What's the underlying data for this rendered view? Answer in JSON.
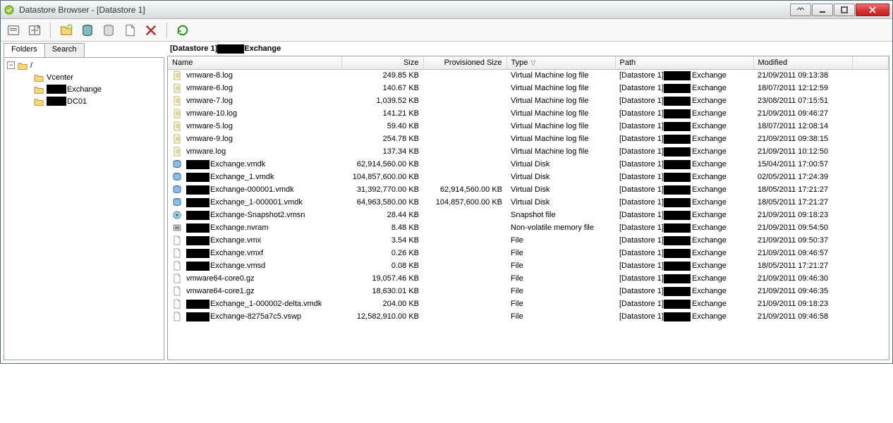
{
  "window": {
    "title": "Datastore Browser - [Datastore 1]"
  },
  "tabs": {
    "folders": "Folders",
    "search": "Search"
  },
  "tree": {
    "root": "/",
    "items": [
      {
        "name": "Vcenter",
        "redacted": false
      },
      {
        "name": "Exchange",
        "redacted": true
      },
      {
        "name": "DC01",
        "redacted": true
      }
    ]
  },
  "breadcrumb": {
    "left": "[Datastore 1]",
    "right": "Exchange"
  },
  "columns": {
    "name": "Name",
    "size": "Size",
    "provisioned": "Provisioned Size",
    "type": "Type",
    "path": "Path",
    "modified": "Modified"
  },
  "pathPrefix": "[Datastore 1]",
  "pathSuffix": "Exchange",
  "files": [
    {
      "icon": "log",
      "redacted": false,
      "name": "vmware-8.log",
      "size": "249.85 KB",
      "prov": "",
      "type": "Virtual Machine log file",
      "mod": "21/09/2011 09:13:38"
    },
    {
      "icon": "log",
      "redacted": false,
      "name": "vmware-6.log",
      "size": "140.67 KB",
      "prov": "",
      "type": "Virtual Machine log file",
      "mod": "18/07/2011 12:12:59"
    },
    {
      "icon": "log",
      "redacted": false,
      "name": "vmware-7.log",
      "size": "1,039.52 KB",
      "prov": "",
      "type": "Virtual Machine log file",
      "mod": "23/08/2011 07:15:51"
    },
    {
      "icon": "log",
      "redacted": false,
      "name": "vmware-10.log",
      "size": "141.21 KB",
      "prov": "",
      "type": "Virtual Machine log file",
      "mod": "21/09/2011 09:46:27"
    },
    {
      "icon": "log",
      "redacted": false,
      "name": "vmware-5.log",
      "size": "59.40 KB",
      "prov": "",
      "type": "Virtual Machine log file",
      "mod": "18/07/2011 12:08:14"
    },
    {
      "icon": "log",
      "redacted": false,
      "name": "vmware-9.log",
      "size": "254.78 KB",
      "prov": "",
      "type": "Virtual Machine log file",
      "mod": "21/09/2011 09:38:15"
    },
    {
      "icon": "log",
      "redacted": false,
      "name": "vmware.log",
      "size": "137.34 KB",
      "prov": "",
      "type": "Virtual Machine log file",
      "mod": "21/09/2011 10:12:50"
    },
    {
      "icon": "disk",
      "redacted": true,
      "name": "Exchange.vmdk",
      "size": "62,914,560.00 KB",
      "prov": "",
      "type": "Virtual Disk",
      "mod": "15/04/2011 17:00:57"
    },
    {
      "icon": "disk",
      "redacted": true,
      "name": "Exchange_1.vmdk",
      "size": "104,857,600.00 KB",
      "prov": "",
      "type": "Virtual Disk",
      "mod": "02/05/2011 17:24:39"
    },
    {
      "icon": "disk",
      "redacted": true,
      "name": "Exchange-000001.vmdk",
      "size": "31,392,770.00 KB",
      "prov": "62,914,560.00 KB",
      "type": "Virtual Disk",
      "mod": "18/05/2011 17:21:27"
    },
    {
      "icon": "disk",
      "redacted": true,
      "name": "Exchange_1-000001.vmdk",
      "size": "64,963,580.00 KB",
      "prov": "104,857,600.00 KB",
      "type": "Virtual Disk",
      "mod": "18/05/2011 17:21:27"
    },
    {
      "icon": "snap",
      "redacted": true,
      "name": "Exchange-Snapshot2.vmsn",
      "size": "28.44 KB",
      "prov": "",
      "type": "Snapshot file",
      "mod": "21/09/2011 09:18:23"
    },
    {
      "icon": "nvram",
      "redacted": true,
      "name": "Exchange.nvram",
      "size": "8.48 KB",
      "prov": "",
      "type": "Non-volatile memory file",
      "mod": "21/09/2011 09:54:50"
    },
    {
      "icon": "file",
      "redacted": true,
      "name": "Exchange.vmx",
      "size": "3.54 KB",
      "prov": "",
      "type": "File",
      "mod": "21/09/2011 09:50:37"
    },
    {
      "icon": "file",
      "redacted": true,
      "name": "Exchange.vmxf",
      "size": "0.26 KB",
      "prov": "",
      "type": "File",
      "mod": "21/09/2011 09:46:57"
    },
    {
      "icon": "file",
      "redacted": true,
      "name": "Exchange.vmsd",
      "size": "0.08 KB",
      "prov": "",
      "type": "File",
      "mod": "18/05/2011 17:21:27"
    },
    {
      "icon": "file",
      "redacted": false,
      "name": "vmware64-core0.gz",
      "size": "19,057.46 KB",
      "prov": "",
      "type": "File",
      "mod": "21/09/2011 09:46:30"
    },
    {
      "icon": "file",
      "redacted": false,
      "name": "vmware64-core1.gz",
      "size": "18,630.01 KB",
      "prov": "",
      "type": "File",
      "mod": "21/09/2011 09:46:35"
    },
    {
      "icon": "file",
      "redacted": true,
      "name": "Exchange_1-000002-delta.vmdk",
      "size": "204.00 KB",
      "prov": "",
      "type": "File",
      "mod": "21/09/2011 09:18:23"
    },
    {
      "icon": "file",
      "redacted": true,
      "name": "Exchange-8275a7c5.vswp",
      "size": "12,582,910.00 KB",
      "prov": "",
      "type": "File",
      "mod": "21/09/2011 09:46:58"
    }
  ]
}
